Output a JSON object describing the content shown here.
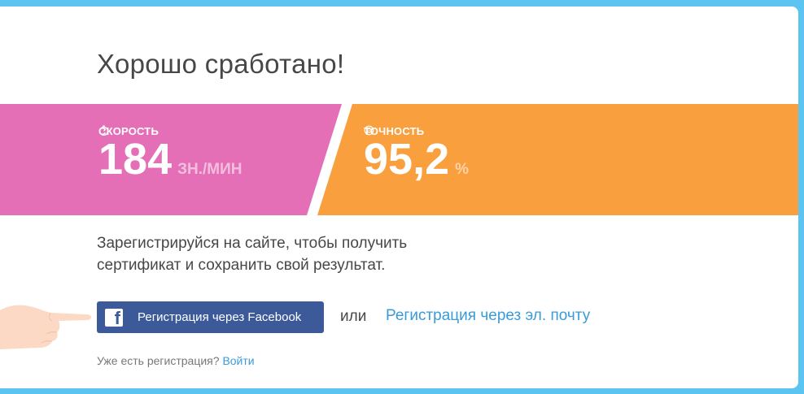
{
  "title": "Хорошо сработано!",
  "stats": {
    "speed": {
      "label": "СКОРОСТЬ",
      "value": "184",
      "unit": "ЗН./МИН",
      "icon": "stopwatch-icon",
      "color": "#e56fb6"
    },
    "accuracy": {
      "label": "ТОЧНОСТЬ",
      "value": "95,2",
      "unit": "%",
      "icon": "target-icon",
      "color": "#f99f3e"
    }
  },
  "prompt": {
    "line1": "Зарегистрируйся на сайте, чтобы получить",
    "line2": "сертификат и сохранить свой результат."
  },
  "signup": {
    "facebook_label": "Регистрация через Facebook",
    "facebook_icon": "facebook-icon",
    "facebook_color": "#3c5a9a",
    "or_label": "или",
    "email_label": "Регистрация через эл. почту"
  },
  "login": {
    "prompt": "Уже есть регистрация?",
    "link_label": "Войти"
  },
  "colors": {
    "background": "#5bc4f1",
    "link": "#3a9bd9"
  }
}
